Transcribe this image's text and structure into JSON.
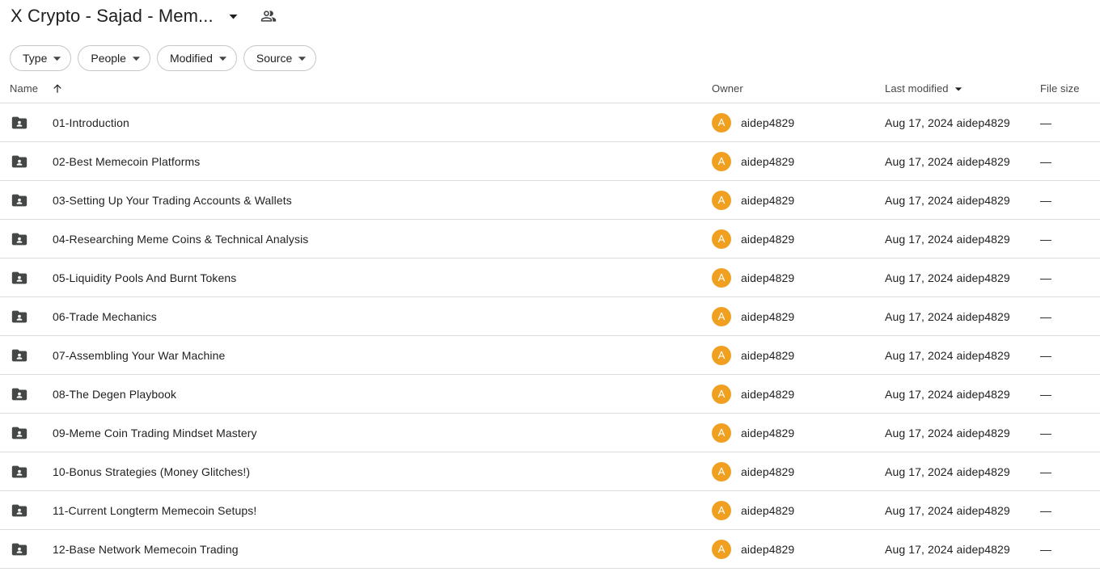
{
  "header": {
    "title": "X Crypto - Sajad - Mem...",
    "title_caret_icon": "chevron-down-icon",
    "people_icon": "people-shared-icon"
  },
  "filters": [
    {
      "label": "Type",
      "icon": "chevron-down-icon"
    },
    {
      "label": "People",
      "icon": "chevron-down-icon"
    },
    {
      "label": "Modified",
      "icon": "chevron-down-icon"
    },
    {
      "label": "Source",
      "icon": "chevron-down-icon"
    }
  ],
  "columns": {
    "name": "Name",
    "name_sort_icon": "arrow-up-icon",
    "owner": "Owner",
    "modified": "Last modified",
    "modified_sort_icon": "chevron-down-icon",
    "size": "File size"
  },
  "colors": {
    "avatar_bg": "#f0a020",
    "folder_icon": "#444746",
    "text": "#1f1f1f",
    "header_text": "#444746",
    "divider": "#dadce0",
    "chip_border": "#c4c7c5"
  },
  "rows": [
    {
      "icon": "shared-folder-icon",
      "name": "01-Introduction",
      "owner_initial": "A",
      "owner": "aidep4829",
      "modified": "Aug 17, 2024 aidep4829",
      "size": "—"
    },
    {
      "icon": "shared-folder-icon",
      "name": "02-Best Memecoin Platforms",
      "owner_initial": "A",
      "owner": "aidep4829",
      "modified": "Aug 17, 2024 aidep4829",
      "size": "—"
    },
    {
      "icon": "shared-folder-icon",
      "name": "03-Setting Up Your Trading Accounts & Wallets",
      "owner_initial": "A",
      "owner": "aidep4829",
      "modified": "Aug 17, 2024 aidep4829",
      "size": "—"
    },
    {
      "icon": "shared-folder-icon",
      "name": "04-Researching Meme Coins & Technical Analysis",
      "owner_initial": "A",
      "owner": "aidep4829",
      "modified": "Aug 17, 2024 aidep4829",
      "size": "—"
    },
    {
      "icon": "shared-folder-icon",
      "name": "05-Liquidity Pools And Burnt Tokens",
      "owner_initial": "A",
      "owner": "aidep4829",
      "modified": "Aug 17, 2024 aidep4829",
      "size": "—"
    },
    {
      "icon": "shared-folder-icon",
      "name": "06-Trade Mechanics",
      "owner_initial": "A",
      "owner": "aidep4829",
      "modified": "Aug 17, 2024 aidep4829",
      "size": "—"
    },
    {
      "icon": "shared-folder-icon",
      "name": "07-Assembling Your War Machine",
      "owner_initial": "A",
      "owner": "aidep4829",
      "modified": "Aug 17, 2024 aidep4829",
      "size": "—"
    },
    {
      "icon": "shared-folder-icon",
      "name": "08-The Degen Playbook",
      "owner_initial": "A",
      "owner": "aidep4829",
      "modified": "Aug 17, 2024 aidep4829",
      "size": "—"
    },
    {
      "icon": "shared-folder-icon",
      "name": "09-Meme Coin Trading Mindset Mastery",
      "owner_initial": "A",
      "owner": "aidep4829",
      "modified": "Aug 17, 2024 aidep4829",
      "size": "—"
    },
    {
      "icon": "shared-folder-icon",
      "name": "10-Bonus Strategies (Money Glitches!)",
      "owner_initial": "A",
      "owner": "aidep4829",
      "modified": "Aug 17, 2024 aidep4829",
      "size": "—"
    },
    {
      "icon": "shared-folder-icon",
      "name": "11-Current Longterm Memecoin Setups!",
      "owner_initial": "A",
      "owner": "aidep4829",
      "modified": "Aug 17, 2024 aidep4829",
      "size": "—"
    },
    {
      "icon": "shared-folder-icon",
      "name": "12-Base Network Memecoin Trading",
      "owner_initial": "A",
      "owner": "aidep4829",
      "modified": "Aug 17, 2024 aidep4829",
      "size": "—"
    }
  ]
}
